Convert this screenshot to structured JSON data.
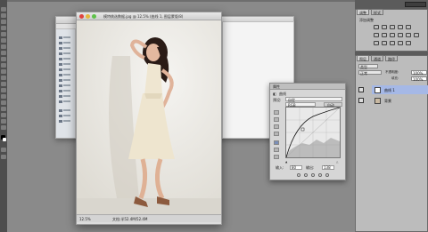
{
  "document": {
    "title": "模特挑选数据.jpg @ 12.5% (曲线 1, 图层蒙版/8)",
    "zoom": "12.5%",
    "doc_info": "文档:半52.4M/52.4M"
  },
  "curves": {
    "title": "属性",
    "tab": "曲线",
    "preset_label": "预设:",
    "preset_value": "自定",
    "channel_value": "RGB",
    "auto_label": "自动",
    "input_label": "输入:",
    "input_value": "80",
    "output_label": "输出:",
    "output_value": "138"
  },
  "adjustments_panel": {
    "tab1": "调整",
    "tab2": "样式",
    "add_label": "添加调整"
  },
  "layers_panel": {
    "tab1": "图层",
    "tab2": "通道",
    "tab3": "路径",
    "kind_label": "类型",
    "blend_mode": "正常",
    "opacity_label": "不透明度:",
    "opacity_value": "100%",
    "fill_label": "填充:",
    "fill_value": "100%",
    "layers": [
      {
        "name": "曲线 1"
      },
      {
        "name": "背景"
      }
    ]
  },
  "colors": {
    "selected_layer": "#a5b8e6",
    "background": "#8a8a8a",
    "close": "#e0443e",
    "minimize": "#e5b83a",
    "zoom": "#5ec24a"
  }
}
